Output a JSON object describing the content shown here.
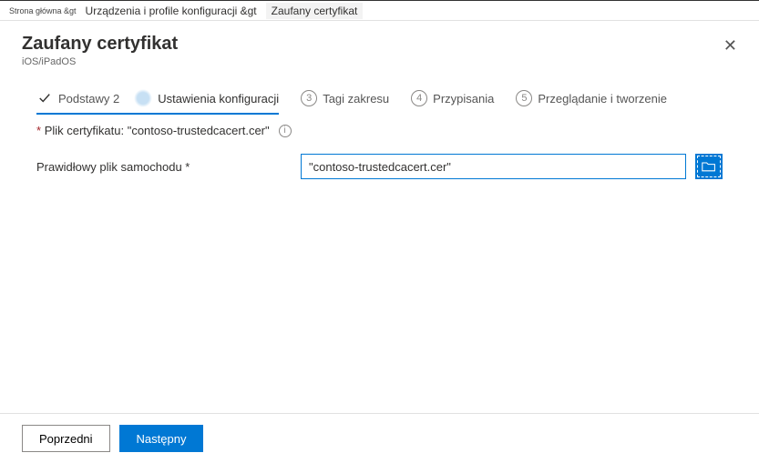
{
  "breadcrumb": {
    "home": "Strona główna &gt",
    "devices": "Urządzenia i profile konfiguracji &gt",
    "current": "Zaufany certyfikat"
  },
  "header": {
    "title": "Zaufany certyfikat",
    "subtitle": "iOS/iPadOS"
  },
  "wizard": {
    "step1": "Podstawy",
    "step1_num": "2",
    "step2": "Ustawienia konfiguracji",
    "step3_num": "3",
    "step3": "Tagi zakresu",
    "step4_num": "4",
    "step4": "Przypisania",
    "step5_num": "5",
    "step5": "Przeglądanie i tworzenie"
  },
  "form": {
    "cert_file_label": "Plik certyfikatu: \"contoso-trustedcacert.cer\"",
    "valid_file_label": "Prawidłowy plik samochodu *",
    "file_value": "\"contoso-trustedcacert.cer\""
  },
  "footer": {
    "prev": "Poprzedni",
    "next": "Następny"
  }
}
